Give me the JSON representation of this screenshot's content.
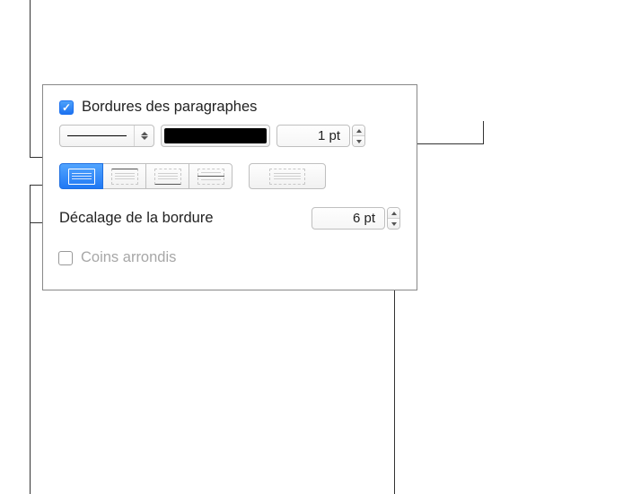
{
  "checkbox": {
    "paragraph_borders_label": "Bordures des paragraphes",
    "paragraph_borders_checked": true,
    "rounded_corners_label": "Coins arrondis",
    "rounded_corners_checked": false
  },
  "line": {
    "style": "solid",
    "color": "#000000",
    "width_value": "1 pt"
  },
  "segments": {
    "positions": [
      "all",
      "top",
      "bottom",
      "left"
    ],
    "isolated": "right",
    "active_index": 0
  },
  "offset": {
    "label": "Décalage de la bordure",
    "value": "6 pt"
  },
  "icons": {
    "line_style_select": "line-style-dropdown",
    "color_well": "color-well",
    "stepper_up": "stepper-up",
    "stepper_down": "stepper-down"
  }
}
